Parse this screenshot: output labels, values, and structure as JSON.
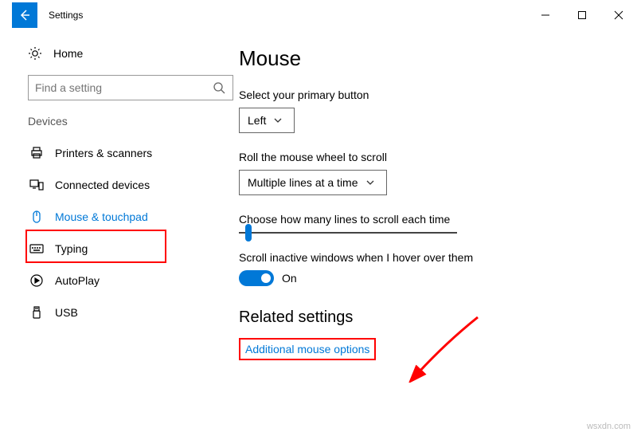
{
  "app": {
    "title": "Settings"
  },
  "sidebar": {
    "home_label": "Home",
    "search_placeholder": "Find a setting",
    "section_label": "Devices",
    "items": [
      {
        "label": "Printers & scanners"
      },
      {
        "label": "Connected devices"
      },
      {
        "label": "Mouse & touchpad"
      },
      {
        "label": "Typing"
      },
      {
        "label": "AutoPlay"
      },
      {
        "label": "USB"
      }
    ]
  },
  "main": {
    "title": "Mouse",
    "primary_button_label": "Select your primary button",
    "primary_button_value": "Left",
    "scroll_mode_label": "Roll the mouse wheel to scroll",
    "scroll_mode_value": "Multiple lines at a time",
    "lines_label": "Choose how many lines to scroll each time",
    "inactive_label": "Scroll inactive windows when I hover over them",
    "toggle_value": "On",
    "related_heading": "Related settings",
    "related_link": "Additional mouse options"
  },
  "watermark": "wsxdn.com"
}
